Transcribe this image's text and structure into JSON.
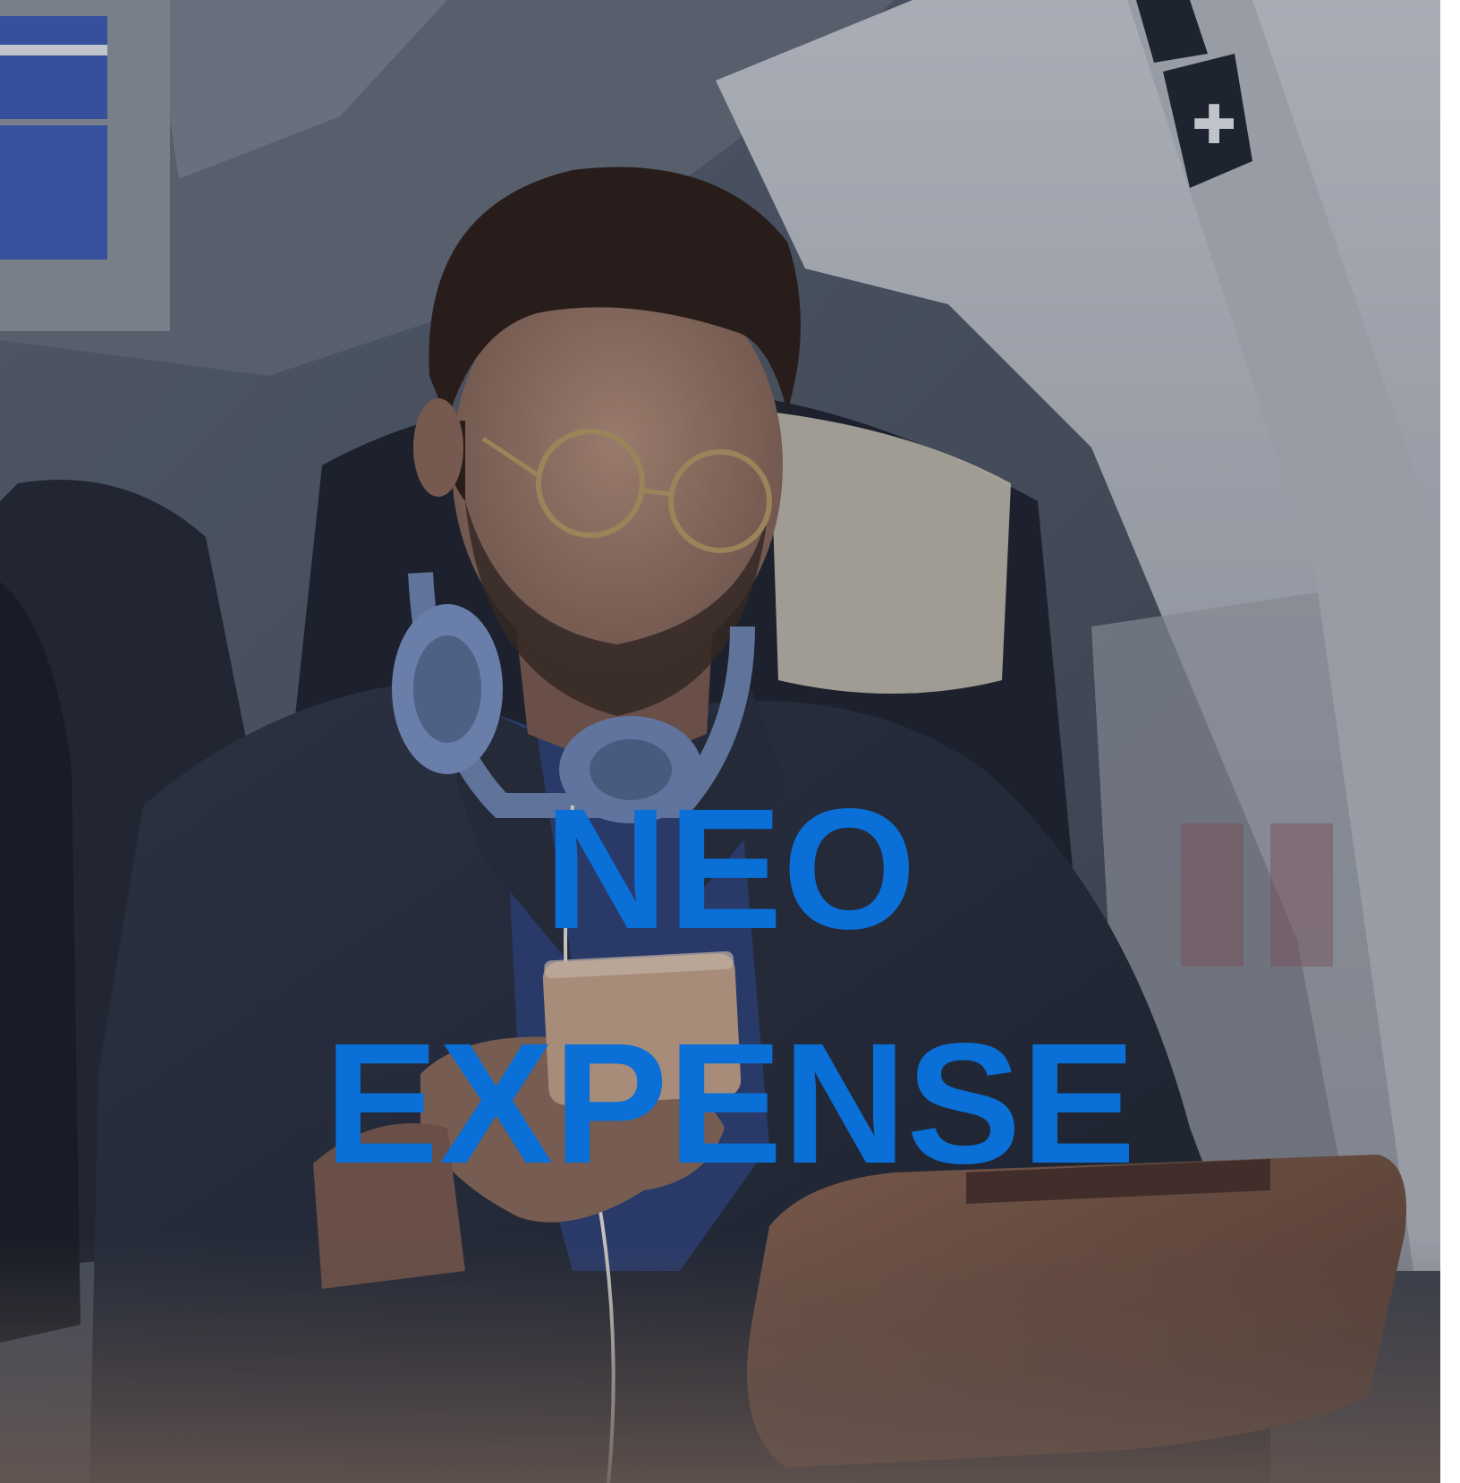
{
  "hero": {
    "title_line_1": "NEO",
    "title_line_2": "EXPENSE",
    "title_color": "#0a6fd6",
    "overlay_color": "#2a2f3a",
    "photo_subject": "man-on-train-with-phone-and-tablet"
  }
}
